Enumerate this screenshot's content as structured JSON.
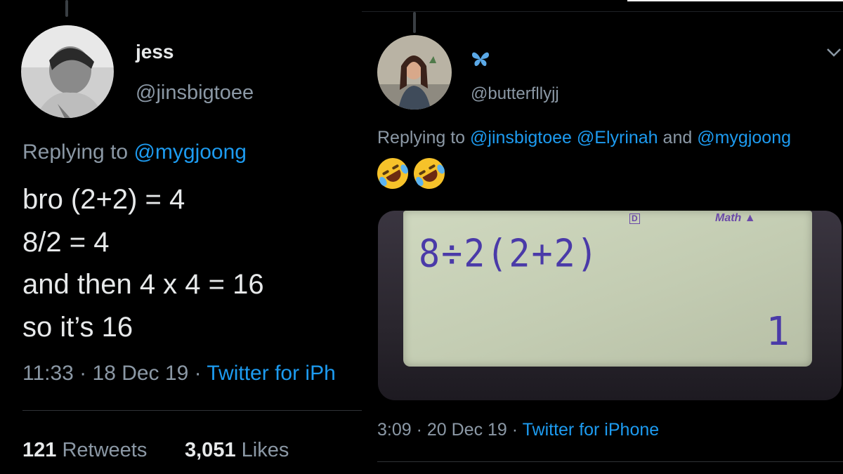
{
  "left_tweet": {
    "name": "jess",
    "handle": "@jinsbigtoee",
    "replying_prefix": "Replying to",
    "replying_to": "@mygjoong",
    "lines": [
      "bro (2+2) = 4",
      "8/2 = 4",
      "and then 4 x 4 = 16",
      "so it’s 16"
    ],
    "time_date": "11:33 · 18 Dec 19 ·",
    "source": "Twitter for iPh",
    "retweets_count": "121",
    "retweets_label": "Retweets",
    "likes_count": "3,051",
    "likes_label": "Likes"
  },
  "right_tweet": {
    "name_icon": "butterfly-icon",
    "handle": "@butterfllyjj",
    "replying_prefix": "Replying to",
    "replying_to": "@jinsbigtoee @Elyrinah",
    "replying_and": "and",
    "replying_to_2": "@mygjoong",
    "emojis": [
      "rolling-on-floor-laughing",
      "rolling-on-floor-laughing"
    ],
    "calculator": {
      "indicator_d": "D",
      "indicator_math": "Math ▲",
      "expression": "8÷2(2+2)",
      "result": "1"
    },
    "time_date": "3:09 · 20 Dec 19 ·",
    "source": "Twitter for iPhone"
  },
  "colors": {
    "background": "#000000",
    "text": "#e7e9ea",
    "muted": "#8b98a5",
    "link": "#1d9bf0"
  }
}
